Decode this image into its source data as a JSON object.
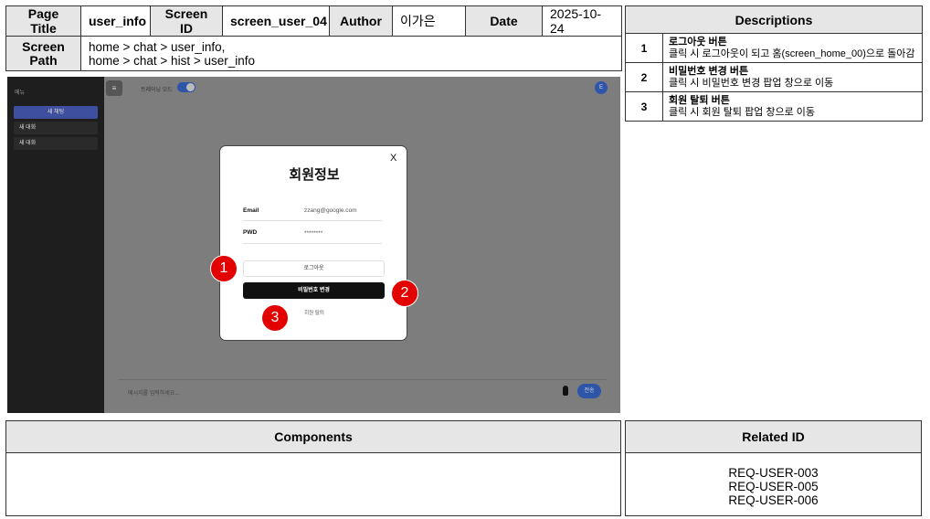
{
  "meta": {
    "page_title_label": "Page Title",
    "page_title_value": "user_info",
    "screen_id_label": "Screen ID",
    "screen_id_value": "screen_user_04",
    "author_label": "Author",
    "author_value": "이가은",
    "date_label": "Date",
    "date_value": "2025-10-24",
    "screen_path_label_1": "Screen",
    "screen_path_label_2": "Path",
    "screen_path_1": "home > chat > user_info,",
    "screen_path_2": "home > chat > hist > user_info"
  },
  "descriptions": {
    "header": "Descriptions",
    "items": [
      {
        "num": "1",
        "title": "로그아웃 버튼",
        "text": "클릭 시 로그아웃이 되고 홈(screen_home_00)으로 돌아감"
      },
      {
        "num": "2",
        "title": "비밀번호 변경 버튼",
        "text": "클릭 시 비밀번호 변경 팝업 창으로 이동"
      },
      {
        "num": "3",
        "title": "회원 탈퇴 버튼",
        "text": "클릭 시 회원 탈퇴 팝업 창으로 이동"
      }
    ]
  },
  "screen": {
    "sidebar": {
      "label": "메뉴",
      "new_chat": "새 채팅",
      "chats": [
        "새 대화",
        "새 대화"
      ]
    },
    "menu_icon": "≡",
    "mode_label": "트레이닝 모드",
    "avatar_initial": "E",
    "message_placeholder": "메시지를 입력하세요...",
    "send_label": "전송",
    "modal": {
      "close": "X",
      "title": "회원정보",
      "email_label": "Email",
      "email_value": "zzang@google.com",
      "pwd_label": "PWD",
      "pwd_value": "********",
      "logout_label": "로그아웃",
      "change_pw_label": "비밀번호 변경",
      "withdraw_label": "회원 탈퇴"
    },
    "markers": [
      "1",
      "2",
      "3"
    ],
    "marker_color": "#e30000",
    "accent_color": "#2e55a8"
  },
  "components": {
    "header": "Components"
  },
  "related": {
    "header": "Related ID",
    "ids": [
      "REQ-USER-003",
      "REQ-USER-005",
      "REQ-USER-006"
    ]
  }
}
